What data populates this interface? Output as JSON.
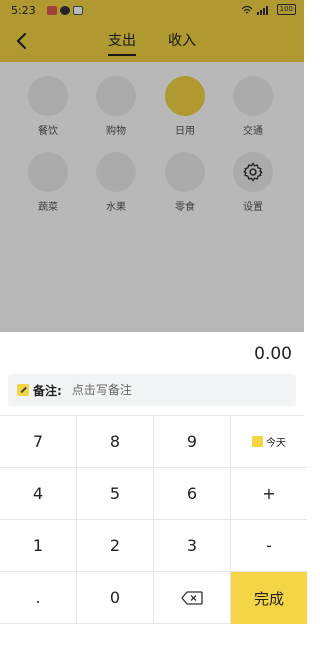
{
  "status_bar": {
    "time": "5:23",
    "battery": "100"
  },
  "header": {
    "tabs": [
      {
        "label": "支出",
        "active": true
      },
      {
        "label": "收入",
        "active": false
      }
    ]
  },
  "categories": [
    {
      "label": "餐饮",
      "selected": false
    },
    {
      "label": "购物",
      "selected": false
    },
    {
      "label": "日用",
      "selected": true
    },
    {
      "label": "交通",
      "selected": false
    },
    {
      "label": "蔬菜",
      "selected": false
    },
    {
      "label": "水果",
      "selected": false
    },
    {
      "label": "零食",
      "selected": false
    },
    {
      "label": "设置",
      "selected": false,
      "icon": "gear-icon"
    }
  ],
  "amount": "0.00",
  "note": {
    "label": "备注:",
    "placeholder": "点击写备注"
  },
  "keypad": {
    "row1": [
      "7",
      "8",
      "9"
    ],
    "row2": [
      "4",
      "5",
      "6"
    ],
    "row3": [
      "1",
      "2",
      "3"
    ],
    "row4": [
      ".",
      "0"
    ],
    "today_label": "今天",
    "plus": "+",
    "minus": "-",
    "done_label": "完成"
  },
  "colors": {
    "accent": "#f4d545",
    "overlay": "rgba(0,0,0,0.28)"
  }
}
